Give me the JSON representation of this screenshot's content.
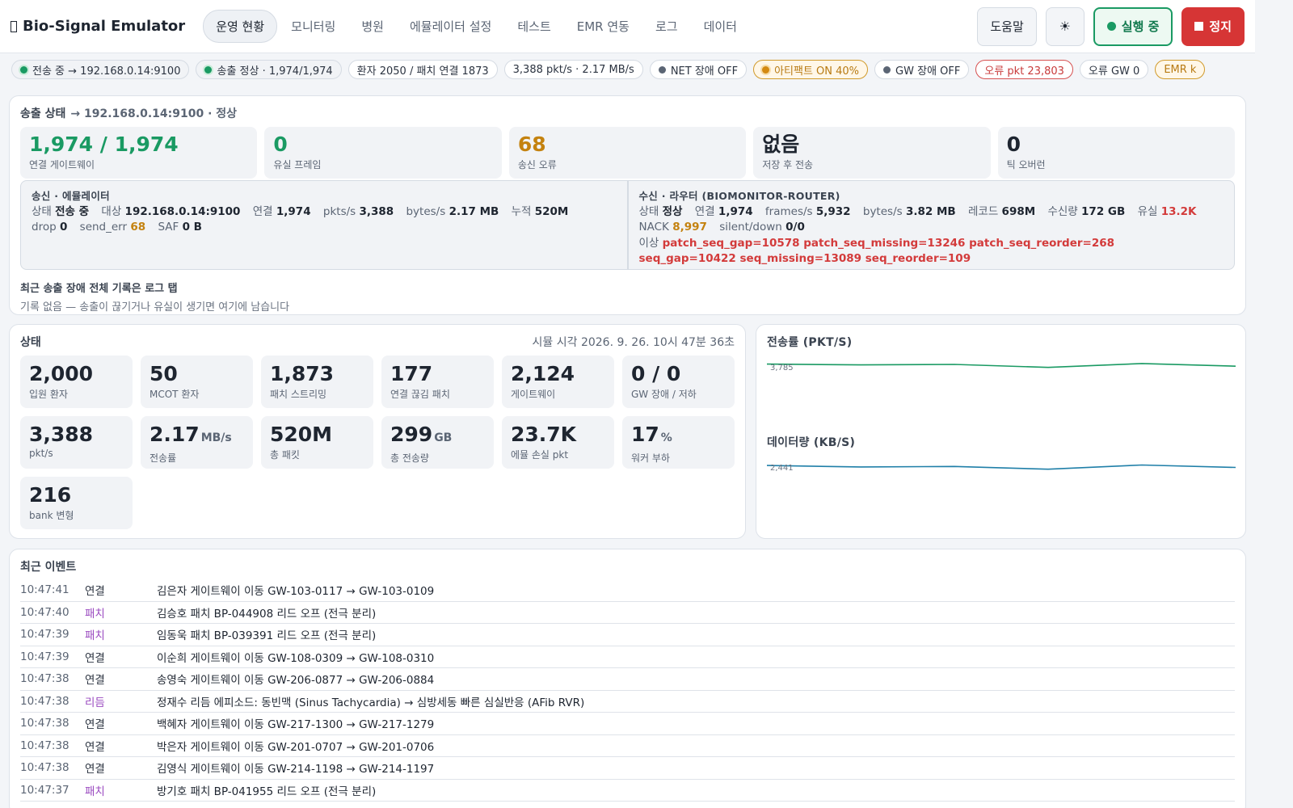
{
  "app": {
    "title": "Bio-Signal Emulator"
  },
  "nav": {
    "items": [
      {
        "label": "운영 현황",
        "active": true
      },
      {
        "label": "모니터링",
        "active": false
      },
      {
        "label": "병원",
        "active": false
      },
      {
        "label": "에뮬레이터 설정",
        "active": false
      },
      {
        "label": "테스트",
        "active": false
      },
      {
        "label": "EMR 연동",
        "active": false
      },
      {
        "label": "로그",
        "active": false
      },
      {
        "label": "데이터",
        "active": false
      }
    ]
  },
  "header": {
    "help_label": "도움말",
    "theme_icon": "☀",
    "running_label": "실행 중",
    "stop_label": "정지"
  },
  "chips": [
    {
      "style": "green",
      "dot": true,
      "label": "전송 중 → 192.168.0.14:9100"
    },
    {
      "style": "green",
      "dot": true,
      "label": "송출 정상 · 1,974/1,974"
    },
    {
      "style": "plain",
      "dot": false,
      "label": "환자 2050 / 패치 연결 1873"
    },
    {
      "style": "plain",
      "dot": false,
      "label": "3,388 pkt/s · 2.17 MB/s"
    },
    {
      "style": "grey",
      "dot": true,
      "label": "NET 장애 OFF"
    },
    {
      "style": "amber",
      "dot": true,
      "label": "아티팩트 ON 40%"
    },
    {
      "style": "grey",
      "dot": true,
      "label": "GW 장애 OFF"
    },
    {
      "style": "red",
      "dot": false,
      "label": "오류 pkt 23,803"
    },
    {
      "style": "plain",
      "dot": false,
      "label": "오류 GW 0"
    },
    {
      "style": "amber",
      "dot": false,
      "label": "EMR k"
    }
  ],
  "transmission": {
    "title": "송출 상태",
    "subtitle": "→ 192.168.0.14:9100 · 정상",
    "stats": [
      {
        "value": "1,974 / 1,974",
        "label": "연결 게이트웨이",
        "color": "green"
      },
      {
        "value": "0",
        "label": "유실 프레임",
        "color": "green"
      },
      {
        "value": "68",
        "label": "송신 오류",
        "color": "amber"
      },
      {
        "value": "없음",
        "label": "저장 후 전송",
        "color": "dark"
      },
      {
        "value": "0",
        "label": "틱 오버런",
        "color": "dark"
      }
    ],
    "sender": {
      "title": "송신 · 에뮬레이터",
      "state_label": "상태",
      "state": "전송 중",
      "target_label": "대상",
      "target": "192.168.0.14:9100",
      "conn_label": "연결",
      "conn": "1,974",
      "pkts_label": "pkts/s",
      "pkts": "3,388",
      "bytes_label": "bytes/s",
      "bytes": "2.17 MB",
      "total_label": "누적",
      "total": "520M",
      "drop_label": "drop",
      "drop": "0",
      "senderr_label": "send_err",
      "senderr": "68",
      "saf_label": "SAF",
      "saf": "0 B"
    },
    "receiver": {
      "title": "수신 · 라우터 (BIOMONITOR-ROUTER)",
      "state_label": "상태",
      "state": "정상",
      "conn_label": "연결",
      "conn": "1,974",
      "frames_label": "frames/s",
      "frames": "5,932",
      "bytes_label": "bytes/s",
      "bytes": "3.82 MB",
      "records_label": "레코드",
      "records": "698M",
      "recv_label": "수신량",
      "recv": "172 GB",
      "lost_label": "유실",
      "lost": "13.2K",
      "nack_label": "NACK",
      "nack": "8,997",
      "silent_label": "silent/down",
      "silent": "0/0",
      "anomaly_label": "이상",
      "anomaly_line1": "patch_seq_gap=10578 patch_seq_missing=13246 patch_seq_reorder=268",
      "anomaly_line2": "seq_gap=10422 seq_missing=13089 seq_reorder=109"
    },
    "history_title": "최근 송출 장애 전체 기록은 로그 탭",
    "history_body": "기록 없음 — 송출이 끊기거나 유실이 생기면 여기에 남습니다"
  },
  "status": {
    "title": "상태",
    "sim_time": "시뮬 시각 2026. 9. 26. 10시 47분 36초",
    "tiles": [
      {
        "value": "2,000",
        "unit": "",
        "label": "입원 환자",
        "color": "dark"
      },
      {
        "value": "50",
        "unit": "",
        "label": "MCOT 환자",
        "color": "dark"
      },
      {
        "value": "1,873",
        "unit": "",
        "label": "패치 스트리밍",
        "color": "green"
      },
      {
        "value": "177",
        "unit": "",
        "label": "연결 끊김 패치",
        "color": "amber"
      },
      {
        "value": "2,124",
        "unit": "",
        "label": "게이트웨이",
        "color": "dark"
      },
      {
        "value": "0 / 0",
        "unit": "",
        "label": "GW 장애 / 저하",
        "color": "dark"
      },
      {
        "value": "3,388",
        "unit": "",
        "label": "pkt/s",
        "color": "green"
      },
      {
        "value": "2.17",
        "unit": "MB/s",
        "label": "전송률",
        "color": "dark"
      },
      {
        "value": "520M",
        "unit": "",
        "label": "총 패킷",
        "color": "dark"
      },
      {
        "value": "299",
        "unit": "GB",
        "label": "총 전송량",
        "color": "dark"
      },
      {
        "value": "23.7K",
        "unit": "",
        "label": "에뮬 손실 pkt",
        "color": "dark"
      },
      {
        "value": "17",
        "unit": "%",
        "label": "워커 부하",
        "color": "green"
      },
      {
        "value": "216",
        "unit": "",
        "label": "bank 변형",
        "color": "dark"
      }
    ]
  },
  "charts": {
    "pkt": {
      "title": "전송률 (PKT/S)",
      "peak_label": "3,785",
      "color": "#1a9a63",
      "ymax": 3785,
      "values": [
        3500,
        3420,
        3470,
        3180,
        3560,
        3300
      ]
    },
    "data": {
      "title": "데이터량 (KB/S)",
      "peak_label": "2,441",
      "color": "#1f7fa8",
      "ymax": 2441,
      "values": [
        2180,
        2090,
        2120,
        1950,
        2210,
        2060
      ]
    }
  },
  "events": {
    "title": "최근 이벤트",
    "rows": [
      {
        "time": "10:47:41",
        "type": "연결",
        "kind": "link",
        "msg": "김은자 게이트웨이 이동 GW-103-0117 → GW-103-0109"
      },
      {
        "time": "10:47:40",
        "type": "패치",
        "kind": "patch",
        "msg": "김승호 패치 BP-044908 리드 오프 (전극 분리)"
      },
      {
        "time": "10:47:39",
        "type": "패치",
        "kind": "patch",
        "msg": "임동욱 패치 BP-039391 리드 오프 (전극 분리)"
      },
      {
        "time": "10:47:39",
        "type": "연결",
        "kind": "link",
        "msg": "이순희 게이트웨이 이동 GW-108-0309 → GW-108-0310"
      },
      {
        "time": "10:47:38",
        "type": "연결",
        "kind": "link",
        "msg": "송영숙 게이트웨이 이동 GW-206-0877 → GW-206-0884"
      },
      {
        "time": "10:47:38",
        "type": "리듬",
        "kind": "rhythm",
        "msg": "정재수 리듬 에피소드: 동빈맥 (Sinus Tachycardia) → 심방세동 빠른 심실반응 (AFib RVR)"
      },
      {
        "time": "10:47:38",
        "type": "연결",
        "kind": "link",
        "msg": "백혜자 게이트웨이 이동 GW-217-1300 → GW-217-1279"
      },
      {
        "time": "10:47:38",
        "type": "연결",
        "kind": "link",
        "msg": "박은자 게이트웨이 이동 GW-201-0707 → GW-201-0706"
      },
      {
        "time": "10:47:38",
        "type": "연결",
        "kind": "link",
        "msg": "김영식 게이트웨이 이동 GW-214-1198 → GW-214-1197"
      },
      {
        "time": "10:47:37",
        "type": "패치",
        "kind": "patch",
        "msg": "방기호 패치 BP-041955 리드 오프 (전극 분리)"
      }
    ]
  }
}
